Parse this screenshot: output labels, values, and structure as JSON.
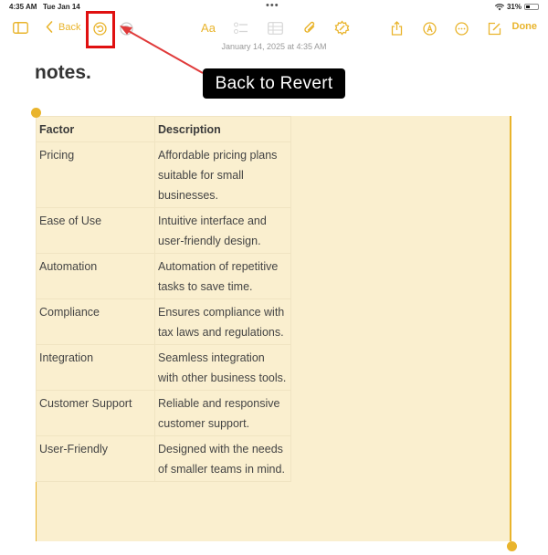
{
  "status_bar": {
    "time": "4:35 AM",
    "date": "Tue Jan 14",
    "multitask_dots": "•••",
    "battery_percent": "31%",
    "battery_level": 0.31
  },
  "toolbar": {
    "sidebar_icon": "sidebar-toggle-icon",
    "back_label": "Back",
    "undo_icon": "undo-icon",
    "redo_icon": "redo-icon",
    "format_label": "Aa",
    "checklist_icon": "checklist-icon",
    "table_icon": "table-icon",
    "attachment_icon": "paperclip-icon",
    "writing_tools_icon": "writing-tools-icon",
    "share_icon": "share-icon",
    "markup_icon": "markup-icon",
    "more_icon": "ellipsis-icon",
    "compose_icon": "compose-icon",
    "done_label": "Done"
  },
  "note": {
    "timestamp": "January 14, 2025 at 4:35 AM",
    "heading": "notes."
  },
  "annotation": {
    "callout_text": "Back to Revert",
    "highlight_color": "#e01010"
  },
  "table": {
    "headers": [
      "Factor",
      "Description"
    ],
    "rows": [
      [
        "Pricing",
        "Affordable pricing plans suitable for small businesses."
      ],
      [
        "Ease of Use",
        "Intuitive interface and user-friendly design."
      ],
      [
        "Automation",
        "Automation of repetitive tasks to save time."
      ],
      [
        "Compliance",
        "Ensures compliance with tax laws and regulations."
      ],
      [
        "Integration",
        "Seamless integration with other business tools."
      ],
      [
        "Customer Support",
        "Reliable and responsive customer support."
      ],
      [
        "User-Friendly",
        "Designed with the needs of smaller teams in mind."
      ]
    ]
  },
  "colors": {
    "accent": "#e9b42c",
    "table_selection_bg": "#faefcf"
  }
}
